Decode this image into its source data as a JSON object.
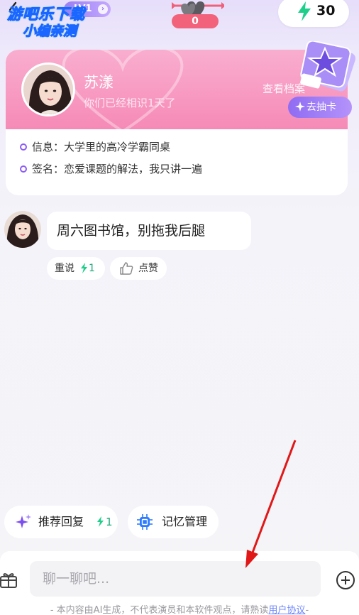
{
  "topbar": {
    "level": "LV1",
    "heart_count": "0",
    "energy": "30"
  },
  "watermark": {
    "line1": "游吧乐下载",
    "line2": "小编亲测"
  },
  "profile": {
    "name": "苏漾",
    "days_text": "你们已经相识1天了",
    "view_profile": "查看档案",
    "draw_card": "去抽卡",
    "info": "信息：大学里的高冷学霸同桌",
    "signature": "签名：恋爱课题的解法，我只讲一遍"
  },
  "chat": {
    "message": "周六图书馆，别拖我后腿",
    "regenerate_label": "重说",
    "regenerate_cost": "1",
    "like_label": "点赞"
  },
  "chips": {
    "suggest_label": "推荐回复",
    "suggest_cost": "1",
    "memory_label": "记忆管理"
  },
  "input": {
    "placeholder": "聊一聊吧..."
  },
  "footer": {
    "disclaimer": "- 本内容由AI生成，不代表演员和本软件观点，请熟读",
    "agreement_link": "用户协议",
    "tail": "-"
  },
  "colors": {
    "accent_purple": "#8b5cf6",
    "pink": "#f68ab7",
    "energy_green": "#1ba87a",
    "annotation_red": "#e01818"
  }
}
